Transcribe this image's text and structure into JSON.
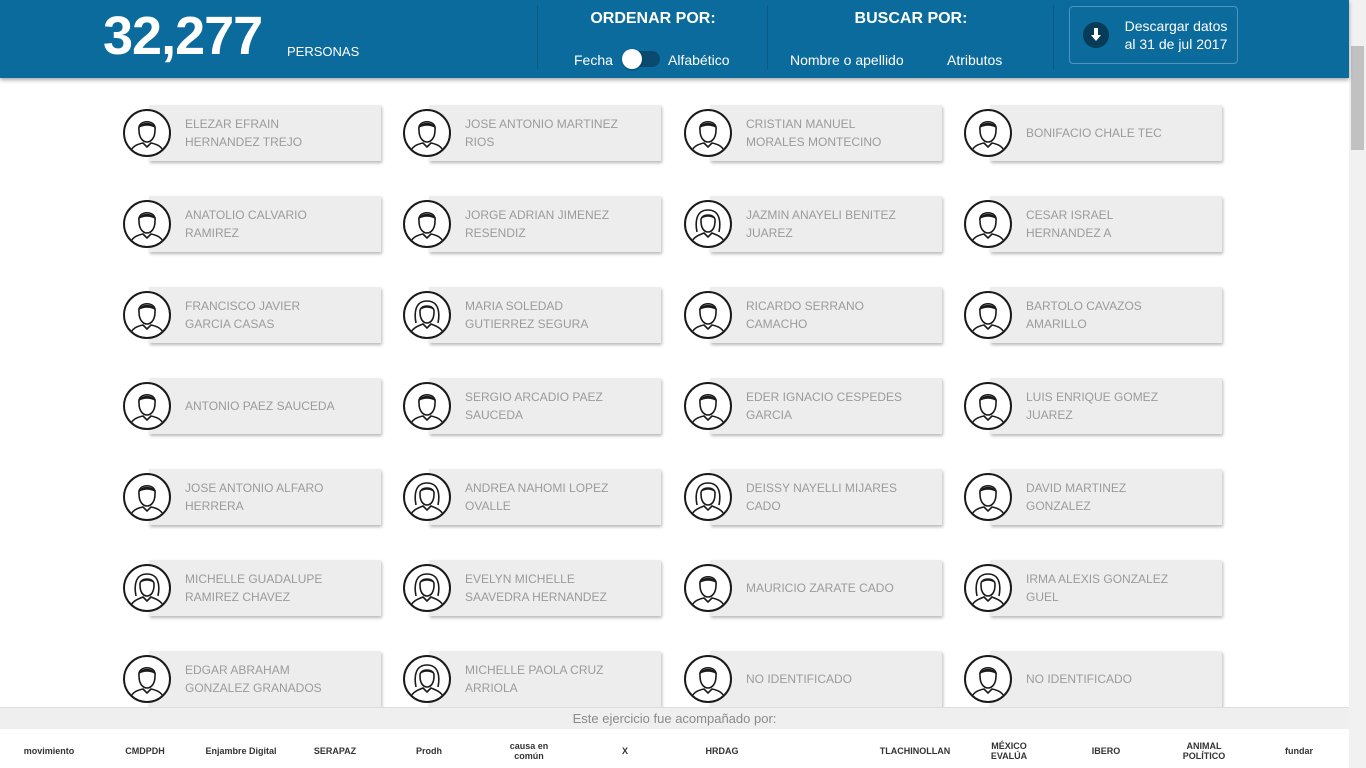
{
  "header": {
    "count": "32,277",
    "count_label": "PERSONAS",
    "sort_title": "ORDENAR POR:",
    "sort_option_1": "Fecha",
    "sort_option_2": "Alfabético",
    "search_title": "BUSCAR POR:",
    "search_option_1": "Nombre o apellido",
    "search_option_2": "Atributos",
    "download_line1": "Descargar datos",
    "download_line2": "al 31 de jul 2017"
  },
  "people": [
    {
      "line1": "ELEZAR EFRAIN",
      "line2": "HERNANDEZ TREJO",
      "gender": "m"
    },
    {
      "line1": "JOSE ANTONIO MARTINEZ",
      "line2": "RIOS",
      "gender": "m"
    },
    {
      "line1": "CRISTIAN MANUEL",
      "line2": "MORALES MONTECINO",
      "gender": "m"
    },
    {
      "line1": "BONIFACIO CHALE TEC",
      "line2": "",
      "gender": "m"
    },
    {
      "line1": "ANATOLIO CALVARIO",
      "line2": "RAMIREZ",
      "gender": "m"
    },
    {
      "line1": "JORGE ADRIAN JIMENEZ",
      "line2": "RESENDIZ",
      "gender": "m"
    },
    {
      "line1": "JAZMIN ANAYELI BENITEZ",
      "line2": "JUAREZ",
      "gender": "f"
    },
    {
      "line1": "CESAR ISRAEL",
      "line2": "HERNANDEZ A",
      "gender": "m"
    },
    {
      "line1": "FRANCISCO JAVIER",
      "line2": "GARCIA CASAS",
      "gender": "m"
    },
    {
      "line1": "MARIA SOLEDAD",
      "line2": "GUTIERREZ SEGURA",
      "gender": "f"
    },
    {
      "line1": "RICARDO SERRANO",
      "line2": "CAMACHO",
      "gender": "m"
    },
    {
      "line1": "BARTOLO CAVAZOS",
      "line2": "AMARILLO",
      "gender": "m"
    },
    {
      "line1": "ANTONIO PAEZ SAUCEDA",
      "line2": "",
      "gender": "m"
    },
    {
      "line1": "SERGIO ARCADIO PAEZ",
      "line2": "SAUCEDA",
      "gender": "m"
    },
    {
      "line1": "EDER IGNACIO CESPEDES",
      "line2": "GARCIA",
      "gender": "m"
    },
    {
      "line1": "LUIS ENRIQUE GOMEZ",
      "line2": "JUAREZ",
      "gender": "m"
    },
    {
      "line1": "JOSE ANTONIO ALFARO",
      "line2": "HERRERA",
      "gender": "m"
    },
    {
      "line1": "ANDREA NAHOMI LOPEZ",
      "line2": "OVALLE",
      "gender": "f"
    },
    {
      "line1": "DEISSY NAYELLI MIJARES",
      "line2": "CADO",
      "gender": "f"
    },
    {
      "line1": "DAVID MARTINEZ",
      "line2": "GONZALEZ",
      "gender": "m"
    },
    {
      "line1": "MICHELLE GUADALUPE",
      "line2": "RAMIREZ CHAVEZ",
      "gender": "f"
    },
    {
      "line1": "EVELYN MICHELLE",
      "line2": "SAAVEDRA HERNANDEZ",
      "gender": "f"
    },
    {
      "line1": "MAURICIO ZARATE CADO",
      "line2": "",
      "gender": "m"
    },
    {
      "line1": "IRMA ALEXIS GONZALEZ",
      "line2": "GUEL",
      "gender": "f"
    },
    {
      "line1": "EDGAR ABRAHAM",
      "line2": "GONZALEZ GRANADOS",
      "gender": "m"
    },
    {
      "line1": "MICHELLE PAOLA CRUZ",
      "line2": "ARRIOLA",
      "gender": "f"
    },
    {
      "line1": "NO IDENTIFICADO",
      "line2": "",
      "gender": "m"
    },
    {
      "line1": "NO IDENTIFICADO",
      "line2": "",
      "gender": "m"
    }
  ],
  "footer": {
    "caption": "Este ejercicio fue acompañado por:",
    "logos": [
      {
        "name": "movimiento",
        "text": "movimiento"
      },
      {
        "name": "cmdpdh",
        "text": "CMDPDH"
      },
      {
        "name": "enjambre-digital",
        "text": "Enjambre Digital"
      },
      {
        "name": "serapaz",
        "text": "SERAPAZ"
      },
      {
        "name": "prodh",
        "text": "Prodh"
      },
      {
        "name": "causa-en-comun",
        "text": "causa en común"
      },
      {
        "name": "x-logo",
        "text": "X"
      },
      {
        "name": "hrdag",
        "text": "HRDAG"
      },
      {
        "name": "fray-juan",
        "text": ""
      },
      {
        "name": "tlachinollan",
        "text": "TLACHINOLLAN"
      },
      {
        "name": "mexico-evalua",
        "text": "MÉXICO EVALÚA"
      },
      {
        "name": "ibero",
        "text": "IBERO"
      },
      {
        "name": "animal-politico",
        "text": "ANIMAL POLÍTICO"
      },
      {
        "name": "fundar",
        "text": "fundar"
      }
    ]
  },
  "colors": {
    "header_bg": "#0b6b9c",
    "card_bg": "#ededed",
    "card_text": "#9b9b9b"
  }
}
